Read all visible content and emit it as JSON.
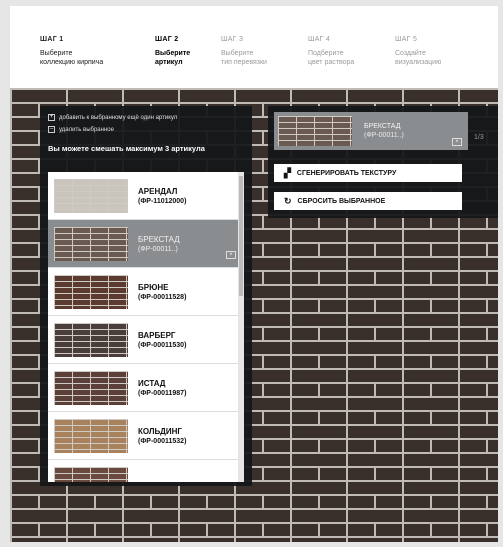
{
  "steps": [
    {
      "number": "ШАГ 1",
      "desc_1": "Выберите",
      "desc_2": "коллекцию кирпича"
    },
    {
      "number": "ШАГ 2",
      "desc_1": "Выберите",
      "desc_2": "артикул"
    },
    {
      "number": "ШАГ 3",
      "desc_1": "Выберите",
      "desc_2": "тип перевязки"
    },
    {
      "number": "ШАГ 4",
      "desc_1": "Подберите",
      "desc_2": "цвет раствора"
    },
    {
      "number": "ШАГ 5",
      "desc_1": "Создайте",
      "desc_2": "визуализацию"
    }
  ],
  "panel": {
    "option_add": "добавить к выбранному ещё один артикул",
    "option_remove": "удалить выбранное",
    "info_text": "Вы можете смешать максимум 3 артикула"
  },
  "articles": [
    {
      "name": "АРЕНДАЛ",
      "code": "(ФР-11012000)",
      "color": "#c9c4bc"
    },
    {
      "name": "БРЕКСТАД",
      "code": "(ФР-00011..)",
      "color": "#6b5a51"
    },
    {
      "name": "БРЮНЕ",
      "code": "(ФР-00011528)",
      "color": "#5b3a30"
    },
    {
      "name": "ВАРБЕРГ",
      "code": "(ФР-00011530)",
      "color": "#4a3e3a"
    },
    {
      "name": "ИСТАД",
      "code": "(ФР-00011987)",
      "color": "#5a4038"
    },
    {
      "name": "КОЛЬДИНГ",
      "code": "(ФР-00011532)",
      "color": "#a7825c"
    },
    {
      "name": "",
      "code": "",
      "color": "#6a4a3e"
    }
  ],
  "selected": {
    "name": "БРЕКСТАД",
    "code": "(ФР-00011..)",
    "counter": "1/3",
    "remove_glyph": "×"
  },
  "buttons": {
    "generate": "СГЕНЕРИРОВАТЬ ТЕКСТУРУ",
    "reset": "СБРОСИТЬ ВЫБРАННОЕ"
  },
  "icons": {
    "checkbox_add": "+",
    "checkbox_remove": "–",
    "generate_icon": "texture-icon",
    "reset_icon": "refresh-icon"
  },
  "colors": {
    "mortar": "#bfbab3",
    "panel_bg": "#141618",
    "selected_bg": "#8a8d90"
  }
}
